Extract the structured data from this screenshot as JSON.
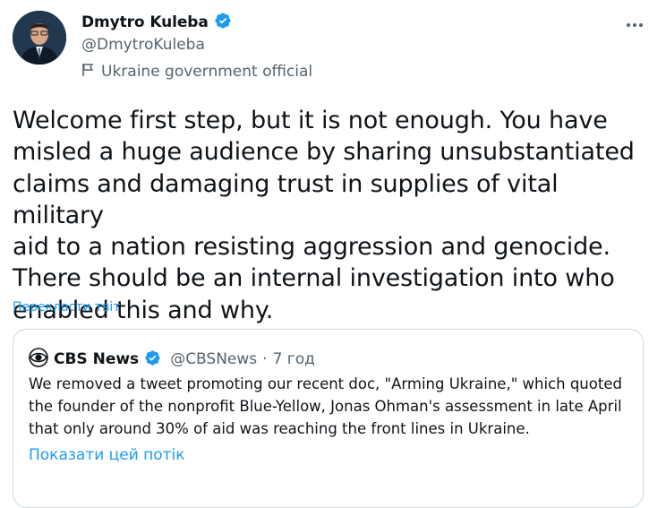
{
  "author": {
    "name": "Dmytro Kuleba",
    "handle": "@DmytroKuleba",
    "label": "Ukraine government official",
    "avatar_icon": "profile-photo",
    "verified_icon": "verified-badge-icon",
    "colors": {
      "verified": "#1d9bf0",
      "secondary": "#536471"
    }
  },
  "tweet": {
    "text": "Welcome first step, but it is not enough. You have\nmisled a huge audience by sharing unsubstantiated\nclaims and damaging trust in supplies of vital military\naid to a nation resisting aggression and genocide.\nThere should be an internal investigation into who\nenabled this and why.",
    "translate_label": "Перекласти твіт"
  },
  "quoted_tweet": {
    "name": "CBS News",
    "handle": "@CBSNews",
    "separator": "·",
    "time": "7 год",
    "text": "We removed a tweet promoting our recent doc, \"Arming Ukraine,\" which quoted\nthe founder of the nonprofit Blue-Yellow, Jonas Ohman's assessment in late April\nthat only around 30% of aid was reaching the front lines in Ukraine.",
    "show_thread_label": "Показати цей потік"
  },
  "colors": {
    "link": "#1d9bf0",
    "text": "#0f1419",
    "border": "#cfd9de"
  }
}
